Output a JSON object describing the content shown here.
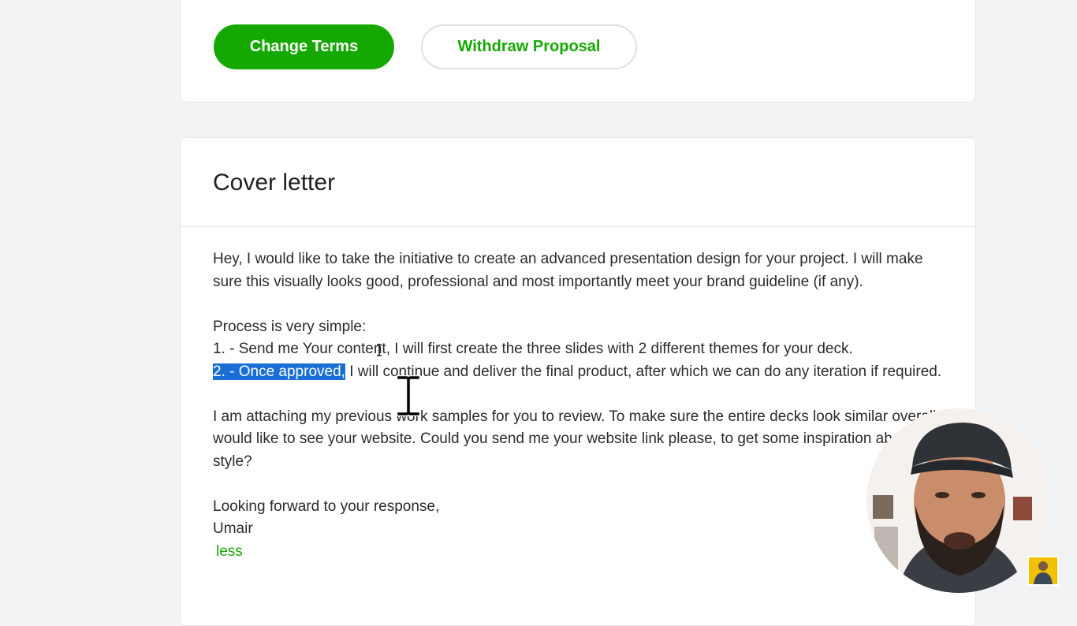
{
  "actions": {
    "change_terms": "Change Terms",
    "withdraw_proposal": "Withdraw Proposal"
  },
  "cover_letter": {
    "title": "Cover letter",
    "paragraph1": "Hey, I would like to take the initiative to create an advanced presentation design for your project. I will make sure this visually looks good, professional and most importantly meet your brand guideline (if any).",
    "process_intro": "Process is very simple:",
    "step1": "1. - Send me Your content, I will first create the three slides with 2 different themes for your deck.",
    "step2_selected": "2. - Once approved,",
    "step2_rest": " I will continue and deliver the final product, after which we can do any iteration if required.",
    "paragraph3": "I am attaching my previous work samples for you to review. To make sure the entire decks look similar overall, I would like to see your website. Could you send me your website link please, to get some inspiration about the style?",
    "closing": "Looking forward to your response,",
    "signature": "Umair",
    "less_link": "less"
  },
  "colors": {
    "brand_green": "#14a800",
    "selection_blue": "#1a6fd6",
    "page_background": "#f2f3f5"
  },
  "icons": {
    "text_cursor": "i-beam-cursor-icon"
  }
}
